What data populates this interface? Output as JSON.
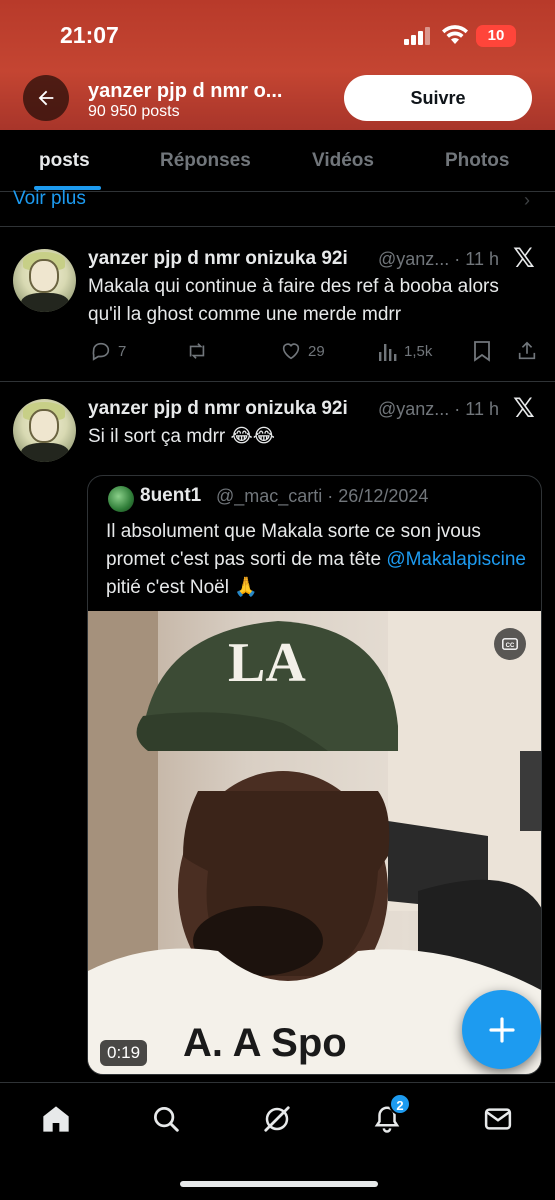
{
  "status_bar": {
    "time": "21:07",
    "battery": "10"
  },
  "header": {
    "title": "yanzer pjp d nmr o...",
    "post_count": "90 950 posts",
    "follow_label": "Suivre",
    "banner_color": "#c44532"
  },
  "tabs": [
    {
      "label": "posts",
      "active": true
    },
    {
      "label": "Réponses",
      "active": false
    },
    {
      "label": "Vidéos",
      "active": false
    },
    {
      "label": "Photos",
      "active": false
    }
  ],
  "voir_plus": "Voir plus",
  "tweets": [
    {
      "name": "yanzer pjp d nmr onizuka 92i",
      "handle": "@yanz... · 11 h",
      "text": "Makala qui continue à faire des ref à booba alors qu'il la ghost comme une merde mdrr",
      "replies": "7",
      "reposts": "",
      "likes": "29",
      "views": "1,5k"
    },
    {
      "name": "yanzer pjp d nmr onizuka 92i",
      "handle": "@yanz... · 11 h",
      "text": "Si il sort ça mdrr 😂😂",
      "quote": {
        "name": "8uent1",
        "handle": "@_mac_carti · 26/12/2024",
        "text_before": "Il absolument que Makala sorte ce son jvous promet c'est pas sorti de ma tête ",
        "mention": "@Makalapiscine",
        "text_after": " pitié c'est Noël 🙏",
        "video_duration": "0:19",
        "cc_label": "CC"
      }
    }
  ],
  "bottom_nav": {
    "notifications_badge": "2",
    "items": [
      "home-icon",
      "search-icon",
      "grok-icon",
      "notifications-icon",
      "messages-icon"
    ]
  },
  "colors": {
    "accent": "#1d9bf0",
    "background": "#000000",
    "text": "#e7e9ea",
    "muted": "#71767b"
  }
}
